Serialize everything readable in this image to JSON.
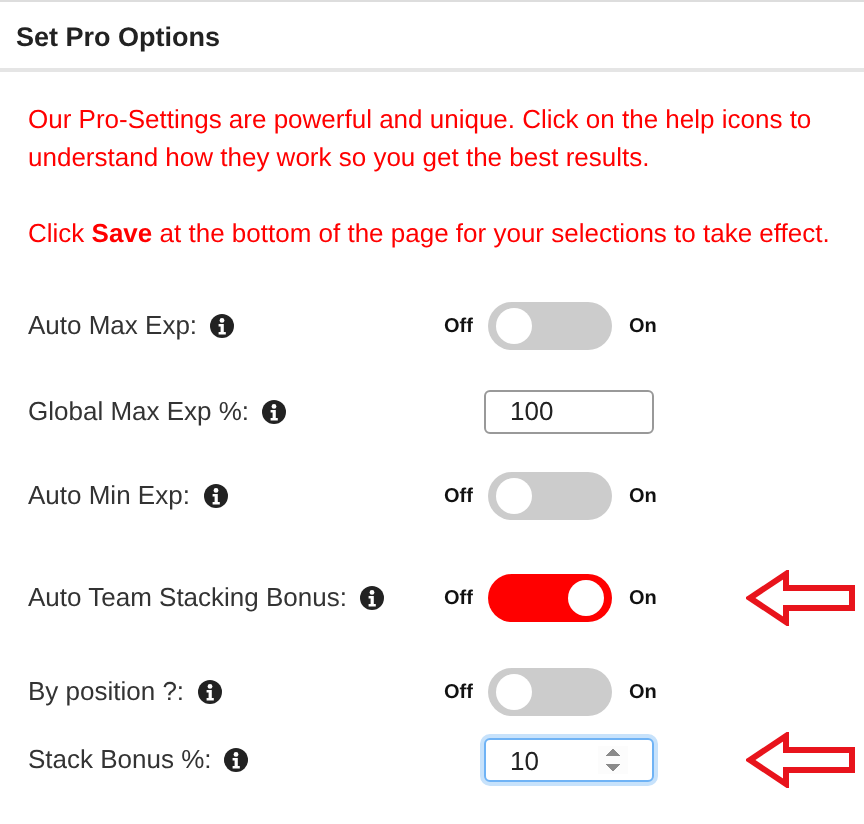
{
  "panel": {
    "title": "Set Pro Options"
  },
  "intro": [
    "Our Pro-Settings are powerful and unique. Click on the help icons to understand how they work so you get the best results.",
    "Click **Save** at the bottom of the page for your selections to take effect."
  ],
  "settings": [
    {
      "label": "Auto Max Exp:",
      "kind": "toggle",
      "off_label": "Off",
      "on_label": "On",
      "on": false,
      "arrow": false
    },
    {
      "label": "Global Max Exp %:",
      "kind": "number",
      "value": "100",
      "focused": false,
      "arrow": false
    },
    {
      "label": "Auto Min Exp:",
      "kind": "toggle",
      "off_label": "Off",
      "on_label": "On",
      "on": false,
      "arrow": false
    },
    {
      "label": "Auto Team Stacking Bonus:",
      "kind": "toggle",
      "off_label": "Off",
      "on_label": "On",
      "on": true,
      "arrow": true
    },
    {
      "label": "By position ?:",
      "kind": "toggle",
      "off_label": "Off",
      "on_label": "On",
      "on": false,
      "arrow": false
    },
    {
      "label": "Stack Bonus %:",
      "kind": "number",
      "value": "10",
      "focused": true,
      "arrow": true
    }
  ]
}
